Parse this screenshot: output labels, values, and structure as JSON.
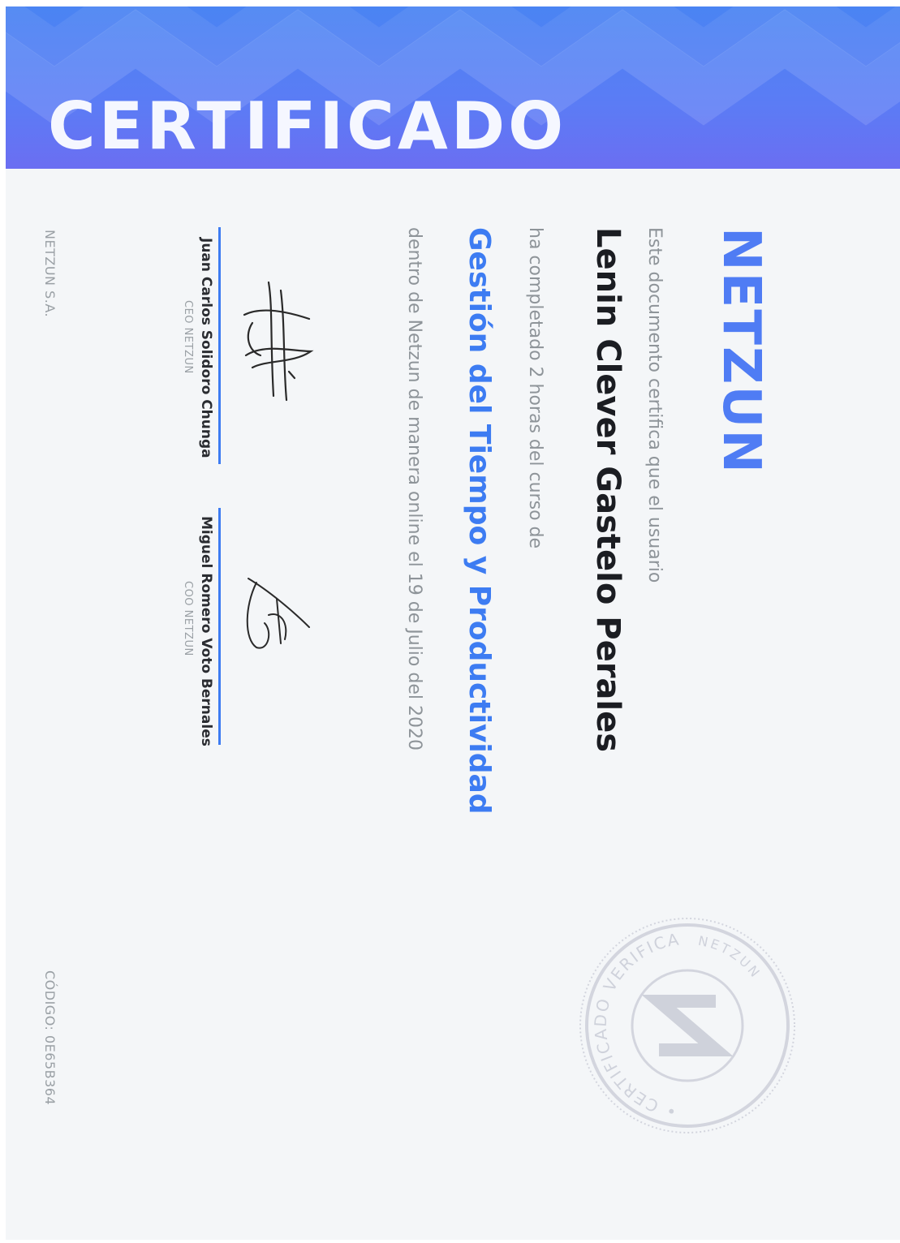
{
  "header": {
    "title": "CERTIFICADO"
  },
  "logo": {
    "text": "NETZUN"
  },
  "body": {
    "intro": "Este documento certifica que el usuario",
    "student_name": "Lenin Clever Gastelo Perales",
    "hours_text": "ha completado 2 horas del curso de",
    "course_name": "Gestión del Tiempo y Productividad",
    "date_text": "dentro de Netzun de manera online el 19 de Julio del 2020"
  },
  "signatures": [
    {
      "name": "Juan Carlos Solidoro Chunga",
      "role": "CEO NETZUN"
    },
    {
      "name": "Miguel Romero Voto Bernales",
      "role": "COO NETZUN"
    }
  ],
  "footer": {
    "company": "NETZUN S.A.",
    "code": "CÓDIGO: 0E65B364"
  },
  "seal": {
    "outer_text": "• CERTIFICADO VERIFICADO •",
    "inner_text": "NETZUN"
  },
  "colors": {
    "header_top": "#4a84f3",
    "header_bottom": "#6b6ef2",
    "accent": "#3d7cf2",
    "muted_text": "#8e9499"
  }
}
